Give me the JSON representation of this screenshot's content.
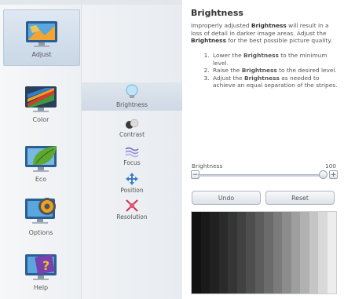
{
  "sidebar": {
    "items": [
      {
        "label": "Adjust",
        "selected": true
      },
      {
        "label": "Color",
        "selected": false
      },
      {
        "label": "Eco",
        "selected": false
      },
      {
        "label": "Options",
        "selected": false
      },
      {
        "label": "Help",
        "selected": false
      }
    ]
  },
  "submenu": {
    "items": [
      {
        "label": "Brightness",
        "selected": true
      },
      {
        "label": "Contrast",
        "selected": false
      },
      {
        "label": "Focus",
        "selected": false
      },
      {
        "label": "Position",
        "selected": false
      },
      {
        "label": "Resolution",
        "selected": false
      }
    ]
  },
  "content": {
    "title": "Brightness",
    "intro": {
      "pre1": "Improperly adjusted ",
      "bold1": "Brightness",
      "mid": " will result in a loss of detail in darker image areas. Adjust the ",
      "bold2": "Brightness",
      "post": " for the best possible picture quality."
    },
    "steps": [
      {
        "pre": "Lower the ",
        "bold": "Brightness",
        "post": " to the minimum level."
      },
      {
        "pre": "Raise the ",
        "bold": "Brightness",
        "post": " to the desired level."
      },
      {
        "pre": "Adjust the ",
        "bold": "Brightness",
        "post": " as needed to achieve an equal separation of the stripes."
      }
    ],
    "slider": {
      "label": "Brightness",
      "value": "100",
      "minus": "−",
      "plus": "+"
    },
    "buttons": {
      "undo": "Undo",
      "reset": "Reset"
    },
    "stripes": [
      "#111111",
      "#191919",
      "#212121",
      "#2a2a2a",
      "#353535",
      "#414141",
      "#4e4e4e",
      "#5c5c5c",
      "#6b6b6b",
      "#7b7b7b",
      "#8c8c8c",
      "#9e9e9e",
      "#b1b1b1",
      "#c5c5c5",
      "#d9d9d9",
      "#ededed"
    ]
  },
  "colors": {
    "selected_bg": "#cfd9e4",
    "accent": "#2e6fb5"
  }
}
